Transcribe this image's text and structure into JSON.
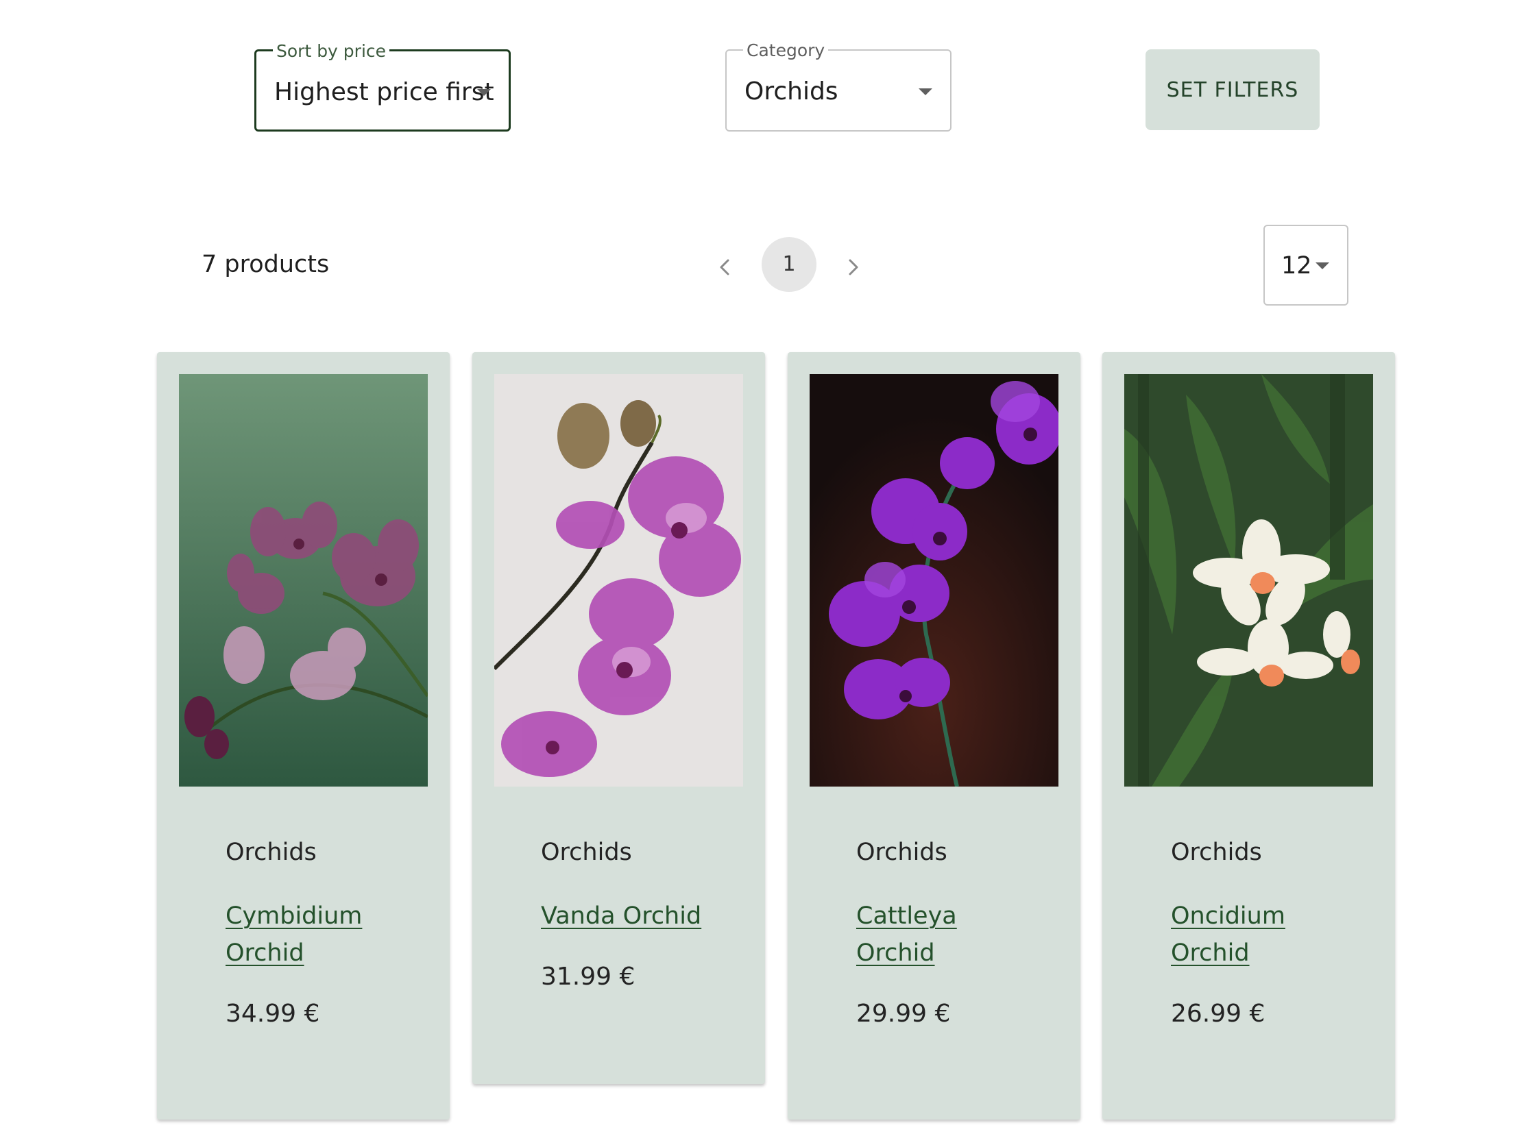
{
  "filters": {
    "sort": {
      "label": "Sort by price",
      "value": "Highest price first"
    },
    "category": {
      "label": "Category",
      "value": "Orchids"
    },
    "set_filters_label": "SET FILTERS"
  },
  "results": {
    "count_label": "7 products",
    "current_page": "1",
    "per_page": "12"
  },
  "products": [
    {
      "category": "Orchids",
      "name": "Cymbidium Orchid",
      "price": "34.99 €",
      "image": "pink-orchid-on-green-background"
    },
    {
      "category": "Orchids",
      "name": "Vanda Orchid",
      "price": "31.99 €",
      "image": "purple-veined-orchid-on-white-background"
    },
    {
      "category": "Orchids",
      "name": "Cattleya Orchid",
      "price": "29.99 €",
      "image": "violet-orchid-on-dark-background"
    },
    {
      "category": "Orchids",
      "name": "Oncidium Orchid",
      "price": "26.99 €",
      "image": "white-orchid-with-green-leaves"
    }
  ],
  "colors": {
    "card_background": "#d6e0da",
    "accent_dark_green": "#1d3b1f",
    "link_green": "#24512b",
    "pagination_active": "#e6e6e6"
  }
}
